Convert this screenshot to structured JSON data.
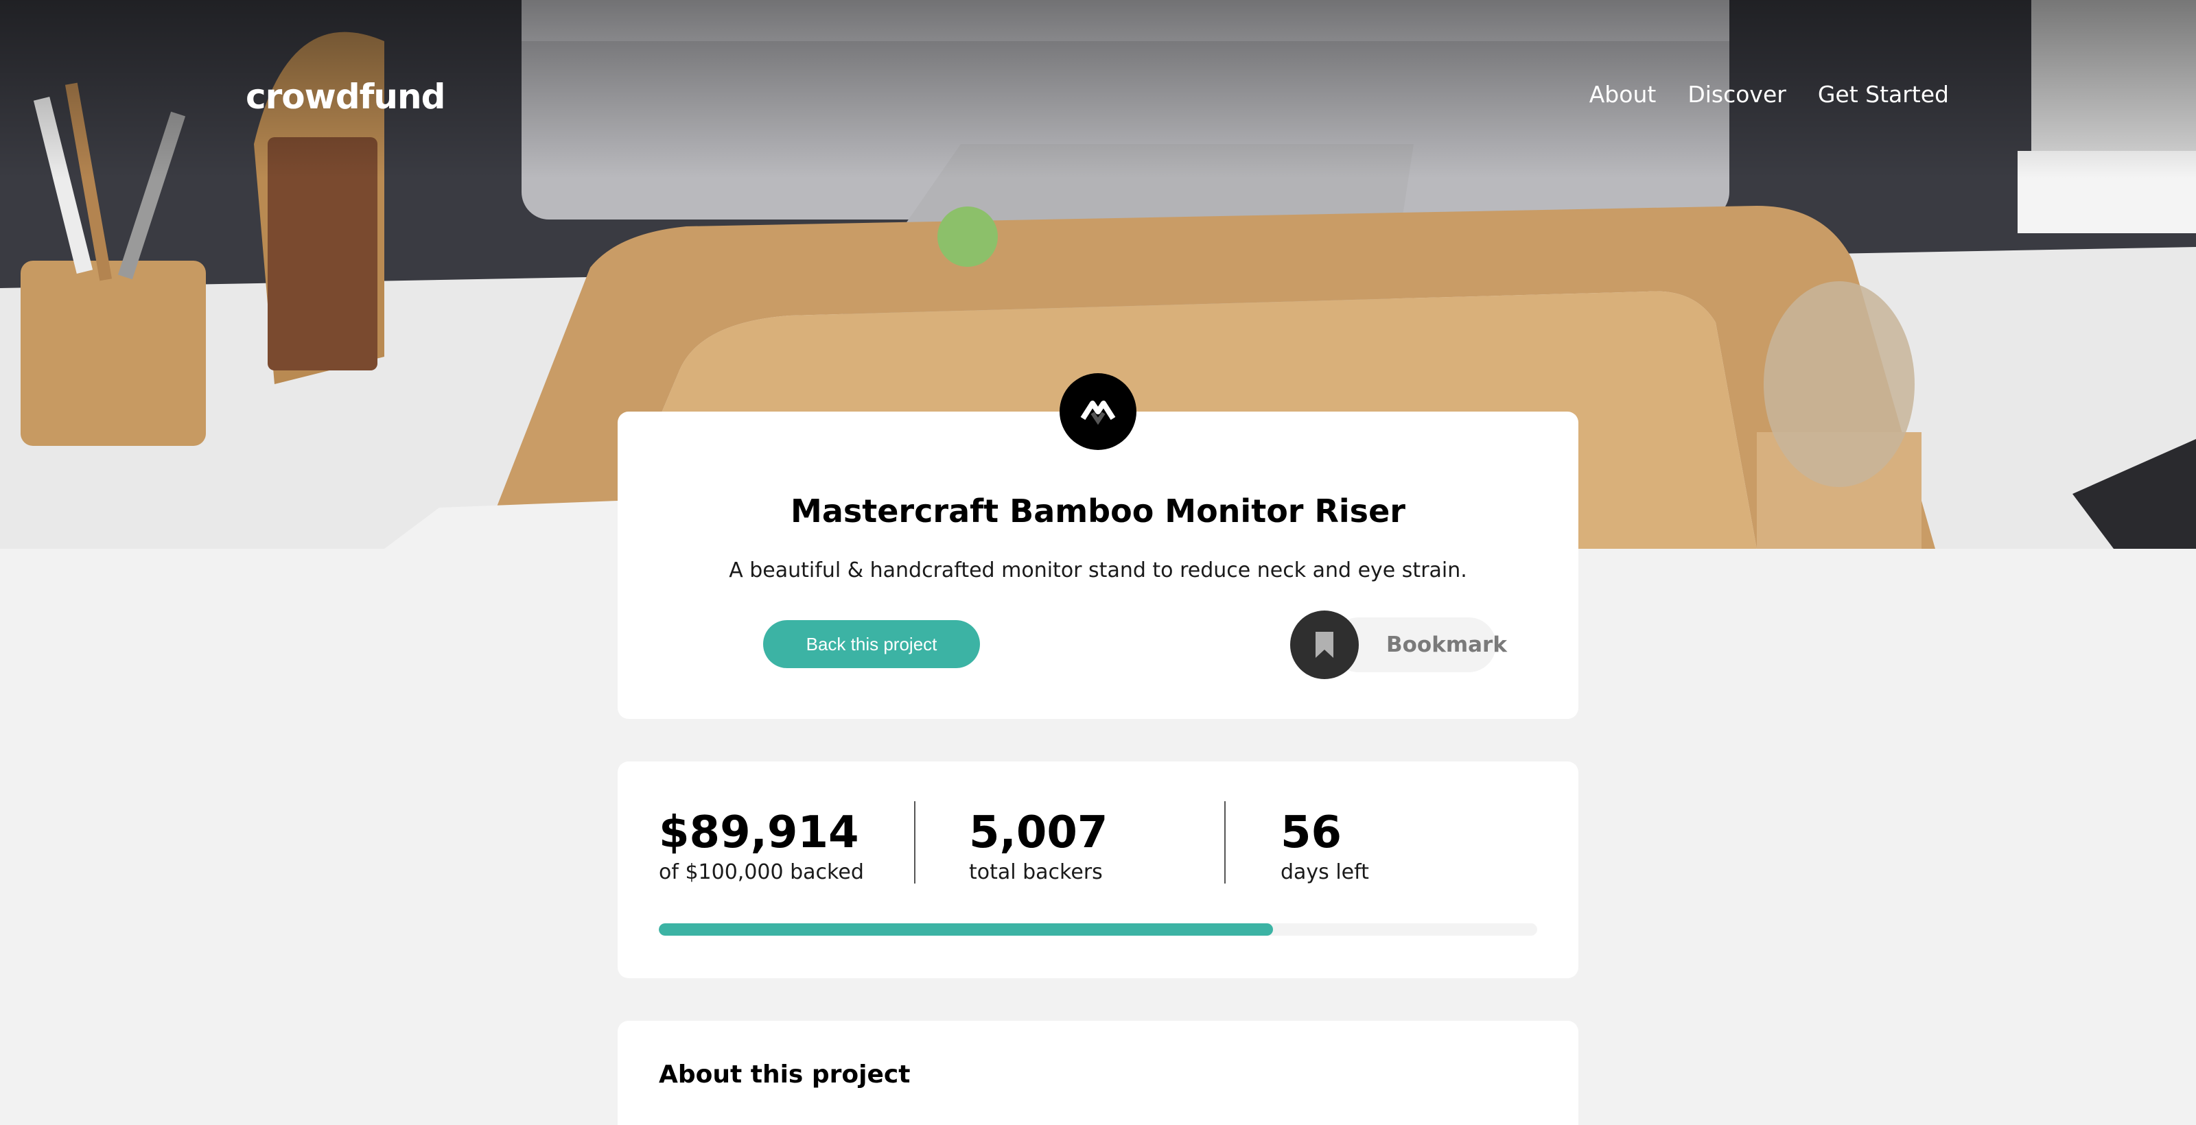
{
  "header": {
    "logo": "crowdfund",
    "nav": [
      "About",
      "Discover",
      "Get Started"
    ]
  },
  "project": {
    "logo_icon": "mastercraft-logo-icon",
    "title": "Mastercraft Bamboo Monitor Riser",
    "description": "A beautiful & handcrafted monitor stand to reduce neck and eye strain.",
    "back_label": "Back this project",
    "bookmark_label": "Bookmark",
    "bookmark_icon": "bookmark-icon"
  },
  "stats": {
    "backed_amount": "$89,914",
    "backed_label": "of $100,000 backed",
    "backers": "5,007",
    "backers_label": "total backers",
    "days": "56",
    "days_label": "days left",
    "progress_fraction": 0.6992
  },
  "about": {
    "title": "About this project"
  },
  "colors": {
    "accent": "#3cb3a4",
    "dark": "#2f2f2f",
    "page_bg": "#f2f2f2"
  }
}
